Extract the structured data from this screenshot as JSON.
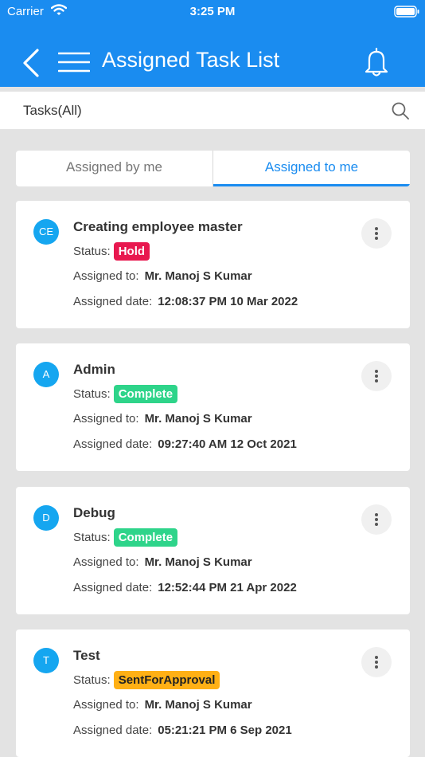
{
  "status_bar": {
    "carrier": "Carrier",
    "time": "3:25 PM"
  },
  "header": {
    "title": "Assigned Task List"
  },
  "search": {
    "label": "Tasks(All)"
  },
  "tabs": [
    {
      "label": "Assigned by me",
      "active": false
    },
    {
      "label": "Assigned to me",
      "active": true
    }
  ],
  "labels": {
    "status": "Status:",
    "assigned_to": "Assigned to:",
    "assigned_date": "Assigned date:"
  },
  "tasks": [
    {
      "initials": "CE",
      "title": "Creating employee master",
      "status": "Hold",
      "status_bg": "#e8184f",
      "status_color": "#ffffff",
      "assigned_to": "Mr. Manoj S Kumar",
      "assigned_date": "12:08:37 PM 10 Mar 2022"
    },
    {
      "initials": "A",
      "title": "Admin",
      "status": "Complete",
      "status_bg": "#2ed48a",
      "status_color": "#ffffff",
      "assigned_to": "Mr. Manoj S Kumar",
      "assigned_date": "09:27:40 AM 12 Oct 2021"
    },
    {
      "initials": "D",
      "title": "Debug",
      "status": "Complete",
      "status_bg": "#2ed48a",
      "status_color": "#ffffff",
      "assigned_to": "Mr. Manoj S Kumar",
      "assigned_date": "12:52:44 PM 21 Apr 2022"
    },
    {
      "initials": "T",
      "title": "Test",
      "status": "SentForApproval",
      "status_bg": "#ffb015",
      "status_color": "#222222",
      "assigned_to": "Mr. Manoj S Kumar",
      "assigned_date": "05:21:21 PM 6 Sep 2021"
    }
  ],
  "colors": {
    "primary": "#1a8cf0",
    "avatar": "#15a6f0"
  }
}
